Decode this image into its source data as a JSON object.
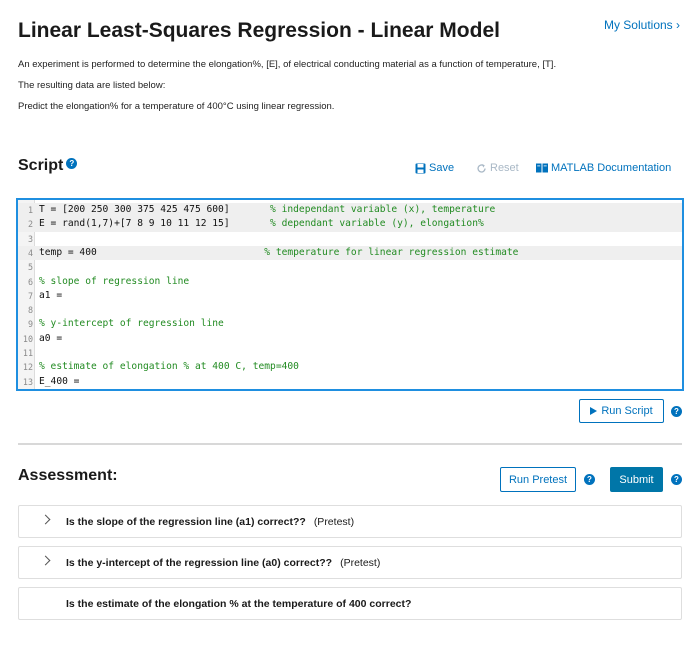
{
  "header": {
    "title": "Linear Least-Squares Regression - Linear Model",
    "my_solutions": "My Solutions ›"
  },
  "problem": {
    "lines": [
      "An experiment is performed to determine the elongation%, [E], of electrical conducting material as a function of temperature, [T].",
      "The resulting data are listed below:",
      "Predict the elongation% for a temperature of 400°C using linear regression."
    ]
  },
  "script": {
    "title": "Script",
    "save_label": "Save",
    "reset_label": "Reset",
    "docs_label": "MATLAB Documentation",
    "run_label": "Run Script",
    "lines": [
      {
        "num": "1",
        "code": "T = [200 250 300 375 425 475 600]",
        "pad": "       ",
        "comment": "% independant variable (x), temperature"
      },
      {
        "num": "2",
        "code": "E = rand(1,7)+[7 8 9 10 11 12 15]",
        "pad": "       ",
        "comment": "% dependant variable (y), elongation%"
      },
      {
        "num": "3",
        "code": "",
        "pad": "",
        "comment": ""
      },
      {
        "num": "4",
        "code": "temp = 400",
        "pad": "                             ",
        "comment": "% temperature for linear regression estimate"
      },
      {
        "num": "5",
        "code": "",
        "pad": "",
        "comment": ""
      },
      {
        "num": "6",
        "code": "",
        "pad": "",
        "comment": "% slope of regression line"
      },
      {
        "num": "7",
        "code": "a1 =",
        "pad": "",
        "comment": ""
      },
      {
        "num": "8",
        "code": "",
        "pad": "",
        "comment": ""
      },
      {
        "num": "9",
        "code": "",
        "pad": "",
        "comment": "% y-intercept of regression line"
      },
      {
        "num": "10",
        "code": "a0 =",
        "pad": "",
        "comment": ""
      },
      {
        "num": "11",
        "code": "",
        "pad": "",
        "comment": ""
      },
      {
        "num": "12",
        "code": "",
        "pad": "",
        "comment": "% estimate of elongation % at 400 C, temp=400"
      },
      {
        "num": "13",
        "code": "E_400 =",
        "pad": "",
        "comment": ""
      }
    ]
  },
  "assessment": {
    "title": "Assessment:",
    "pretest_label": "Run Pretest",
    "submit_label": "Submit",
    "items": [
      {
        "text": "Is the slope of the regression line (a1) correct??",
        "tag": "(Pretest)"
      },
      {
        "text": "Is the y-intercept of the regression line (a0) correct??",
        "tag": "(Pretest)"
      },
      {
        "text": "Is the estimate of the elongation % at the temperature of 400 correct?",
        "tag": ""
      }
    ]
  },
  "colors": {
    "accent": "#0072bd",
    "editor_border": "#1f8fe0",
    "comment": "#228b22",
    "submit": "#0076a8"
  }
}
